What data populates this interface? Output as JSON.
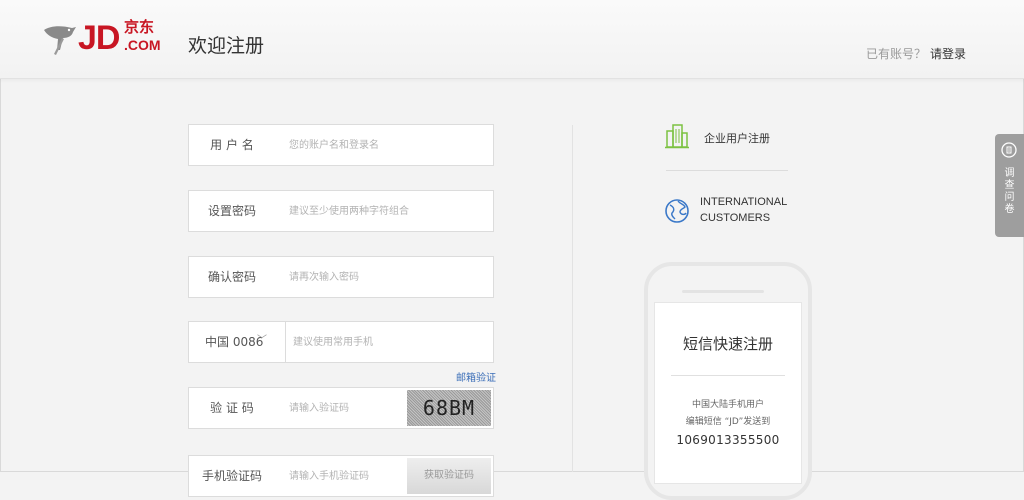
{
  "header": {
    "logo": {
      "jd": "JD",
      "cn": "京东",
      "com": ".COM"
    },
    "title": "欢迎注册",
    "login_prompt": "已有账号？",
    "login_link": "请登录"
  },
  "form": {
    "username": {
      "label": "用 户 名",
      "placeholder": "您的账户名和登录名"
    },
    "password": {
      "label": "设置密码",
      "placeholder": "建议至少使用两种字符组合"
    },
    "confirm": {
      "label": "确认密码",
      "placeholder": "请再次输入密码"
    },
    "phone": {
      "country": "中国 0086",
      "placeholder": "建议使用常用手机"
    },
    "email_verify": "邮箱验证",
    "captcha": {
      "label": "验 证 码",
      "placeholder": "请输入验证码",
      "image_text": "68BM"
    },
    "sms_code": {
      "label": "手机验证码",
      "placeholder": "请输入手机验证码",
      "button": "获取验证码"
    }
  },
  "side": {
    "enterprise": "企业用户注册",
    "international": [
      "INTERNATIONAL",
      "CUSTOMERS"
    ],
    "sms": {
      "title": "短信快速注册",
      "line1": "中国大陆手机用户",
      "line2": "编辑短信 “JD”发送到",
      "number": "1069013355500"
    }
  },
  "survey": {
    "label": "调查问卷"
  },
  "colors": {
    "brand": "#c81623",
    "link": "#3c6fb8",
    "enterprise_icon": "#7cc242",
    "globe_icon": "#3a78c8"
  }
}
